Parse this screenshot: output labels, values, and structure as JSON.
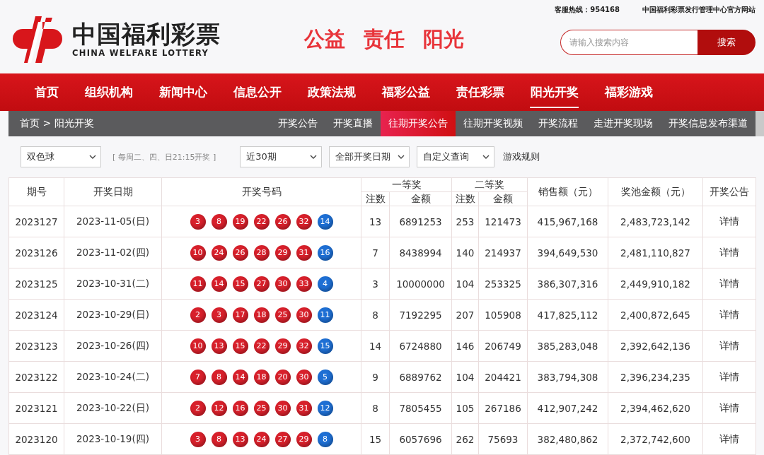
{
  "header": {
    "hotline": "客服热线：954168",
    "site_note": "中国福利彩票发行管理中心官方网站",
    "logo_cn": "中国福利彩票",
    "logo_en": "CHINA WELFARE LOTTERY",
    "slogans": [
      "公益",
      "责任",
      "阳光"
    ],
    "search": {
      "placeholder": "请输入搜索内容",
      "button": "搜索"
    }
  },
  "nav": [
    {
      "label": "首页",
      "selected": false
    },
    {
      "label": "组织机构",
      "selected": false
    },
    {
      "label": "新闻中心",
      "selected": false
    },
    {
      "label": "信息公开",
      "selected": false
    },
    {
      "label": "政策法规",
      "selected": false
    },
    {
      "label": "福彩公益",
      "selected": false
    },
    {
      "label": "责任彩票",
      "selected": false
    },
    {
      "label": "阳光开奖",
      "selected": true
    },
    {
      "label": "福彩游戏",
      "selected": false
    }
  ],
  "breadcrumb": "首页 > 阳光开奖",
  "subnav": [
    {
      "label": "开奖公告",
      "selected": false
    },
    {
      "label": "开奖直播",
      "selected": false
    },
    {
      "label": "往期开奖公告",
      "selected": true
    },
    {
      "label": "往期开奖视频",
      "selected": false
    },
    {
      "label": "开奖流程",
      "selected": false
    },
    {
      "label": "走进开奖现场",
      "selected": false
    },
    {
      "label": "开奖信息发布渠道",
      "selected": false
    }
  ],
  "filters": {
    "game": "双色球",
    "schedule": "[ 每周二、四、日21:15开奖 ]",
    "period": "近30期",
    "date": "全部开奖日期",
    "custom": "自定义查询",
    "rules": "游戏规则"
  },
  "table": {
    "columns": {
      "issue": "期号",
      "date": "开奖日期",
      "numbers": "开奖号码",
      "first": "一等奖",
      "second": "二等奖",
      "first_count": "注数",
      "first_amount": "金额",
      "second_count": "注数",
      "second_amount": "金额",
      "sales": "销售额（元）",
      "pool": "奖池金额（元）",
      "notice": "开奖公告"
    },
    "rows": [
      {
        "issue": "2023127",
        "date": "2023-11-05(日)",
        "balls": [
          {
            "n": "3",
            "color": "#d8202b"
          },
          {
            "n": "8",
            "color": "#d8202b"
          },
          {
            "n": "19",
            "color": "#d8202b"
          },
          {
            "n": "22",
            "color": "#d8202b"
          },
          {
            "n": "26",
            "color": "#d8202b"
          },
          {
            "n": "32",
            "color": "#d8202b"
          },
          {
            "n": "14",
            "color": "#1e6fd4"
          }
        ],
        "first_count": "13",
        "first_amount": "6891253",
        "second_count": "253",
        "second_amount": "121473",
        "sales": "415,967,168",
        "pool": "2,483,723,142",
        "notice": "详情"
      },
      {
        "issue": "2023126",
        "date": "2023-11-02(四)",
        "balls": [
          {
            "n": "10",
            "color": "#d8202b"
          },
          {
            "n": "24",
            "color": "#d8202b"
          },
          {
            "n": "26",
            "color": "#d8202b"
          },
          {
            "n": "28",
            "color": "#d8202b"
          },
          {
            "n": "29",
            "color": "#d8202b"
          },
          {
            "n": "31",
            "color": "#d8202b"
          },
          {
            "n": "16",
            "color": "#1e6fd4"
          }
        ],
        "first_count": "7",
        "first_amount": "8438994",
        "second_count": "140",
        "second_amount": "214937",
        "sales": "394,649,530",
        "pool": "2,481,110,827",
        "notice": "详情"
      },
      {
        "issue": "2023125",
        "date": "2023-10-31(二)",
        "balls": [
          {
            "n": "11",
            "color": "#d8202b"
          },
          {
            "n": "14",
            "color": "#d8202b"
          },
          {
            "n": "15",
            "color": "#d8202b"
          },
          {
            "n": "27",
            "color": "#d8202b"
          },
          {
            "n": "30",
            "color": "#d8202b"
          },
          {
            "n": "33",
            "color": "#d8202b"
          },
          {
            "n": "4",
            "color": "#1e6fd4"
          }
        ],
        "first_count": "3",
        "first_amount": "10000000",
        "second_count": "104",
        "second_amount": "253325",
        "sales": "386,307,316",
        "pool": "2,449,910,182",
        "notice": "详情"
      },
      {
        "issue": "2023124",
        "date": "2023-10-29(日)",
        "balls": [
          {
            "n": "2",
            "color": "#d8202b"
          },
          {
            "n": "3",
            "color": "#d8202b"
          },
          {
            "n": "17",
            "color": "#d8202b"
          },
          {
            "n": "18",
            "color": "#d8202b"
          },
          {
            "n": "25",
            "color": "#d8202b"
          },
          {
            "n": "30",
            "color": "#d8202b"
          },
          {
            "n": "11",
            "color": "#1e6fd4"
          }
        ],
        "first_count": "8",
        "first_amount": "7192295",
        "second_count": "207",
        "second_amount": "105908",
        "sales": "417,825,112",
        "pool": "2,400,872,645",
        "notice": "详情"
      },
      {
        "issue": "2023123",
        "date": "2023-10-26(四)",
        "balls": [
          {
            "n": "10",
            "color": "#d8202b"
          },
          {
            "n": "13",
            "color": "#d8202b"
          },
          {
            "n": "15",
            "color": "#d8202b"
          },
          {
            "n": "22",
            "color": "#d8202b"
          },
          {
            "n": "29",
            "color": "#d8202b"
          },
          {
            "n": "32",
            "color": "#d8202b"
          },
          {
            "n": "15",
            "color": "#1e6fd4"
          }
        ],
        "first_count": "14",
        "first_amount": "6724880",
        "second_count": "146",
        "second_amount": "206749",
        "sales": "385,283,048",
        "pool": "2,392,642,136",
        "notice": "详情"
      },
      {
        "issue": "2023122",
        "date": "2023-10-24(二)",
        "balls": [
          {
            "n": "7",
            "color": "#d8202b"
          },
          {
            "n": "8",
            "color": "#d8202b"
          },
          {
            "n": "14",
            "color": "#d8202b"
          },
          {
            "n": "18",
            "color": "#d8202b"
          },
          {
            "n": "20",
            "color": "#d8202b"
          },
          {
            "n": "30",
            "color": "#d8202b"
          },
          {
            "n": "5",
            "color": "#1e6fd4"
          }
        ],
        "first_count": "9",
        "first_amount": "6889762",
        "second_count": "104",
        "second_amount": "204421",
        "sales": "383,794,308",
        "pool": "2,396,234,235",
        "notice": "详情"
      },
      {
        "issue": "2023121",
        "date": "2023-10-22(日)",
        "balls": [
          {
            "n": "2",
            "color": "#d8202b"
          },
          {
            "n": "12",
            "color": "#d8202b"
          },
          {
            "n": "16",
            "color": "#d8202b"
          },
          {
            "n": "25",
            "color": "#d8202b"
          },
          {
            "n": "30",
            "color": "#d8202b"
          },
          {
            "n": "31",
            "color": "#d8202b"
          },
          {
            "n": "12",
            "color": "#1e6fd4"
          }
        ],
        "first_count": "8",
        "first_amount": "7805455",
        "second_count": "105",
        "second_amount": "267186",
        "sales": "412,907,242",
        "pool": "2,394,462,620",
        "notice": "详情"
      },
      {
        "issue": "2023120",
        "date": "2023-10-19(四)",
        "balls": [
          {
            "n": "3",
            "color": "#d8202b"
          },
          {
            "n": "8",
            "color": "#d8202b"
          },
          {
            "n": "13",
            "color": "#d8202b"
          },
          {
            "n": "24",
            "color": "#d8202b"
          },
          {
            "n": "27",
            "color": "#d8202b"
          },
          {
            "n": "29",
            "color": "#d8202b"
          },
          {
            "n": "8",
            "color": "#1e6fd4"
          }
        ],
        "first_count": "15",
        "first_amount": "6057696",
        "second_count": "262",
        "second_amount": "75693",
        "sales": "382,480,862",
        "pool": "2,372,742,600",
        "notice": "详情"
      }
    ]
  }
}
